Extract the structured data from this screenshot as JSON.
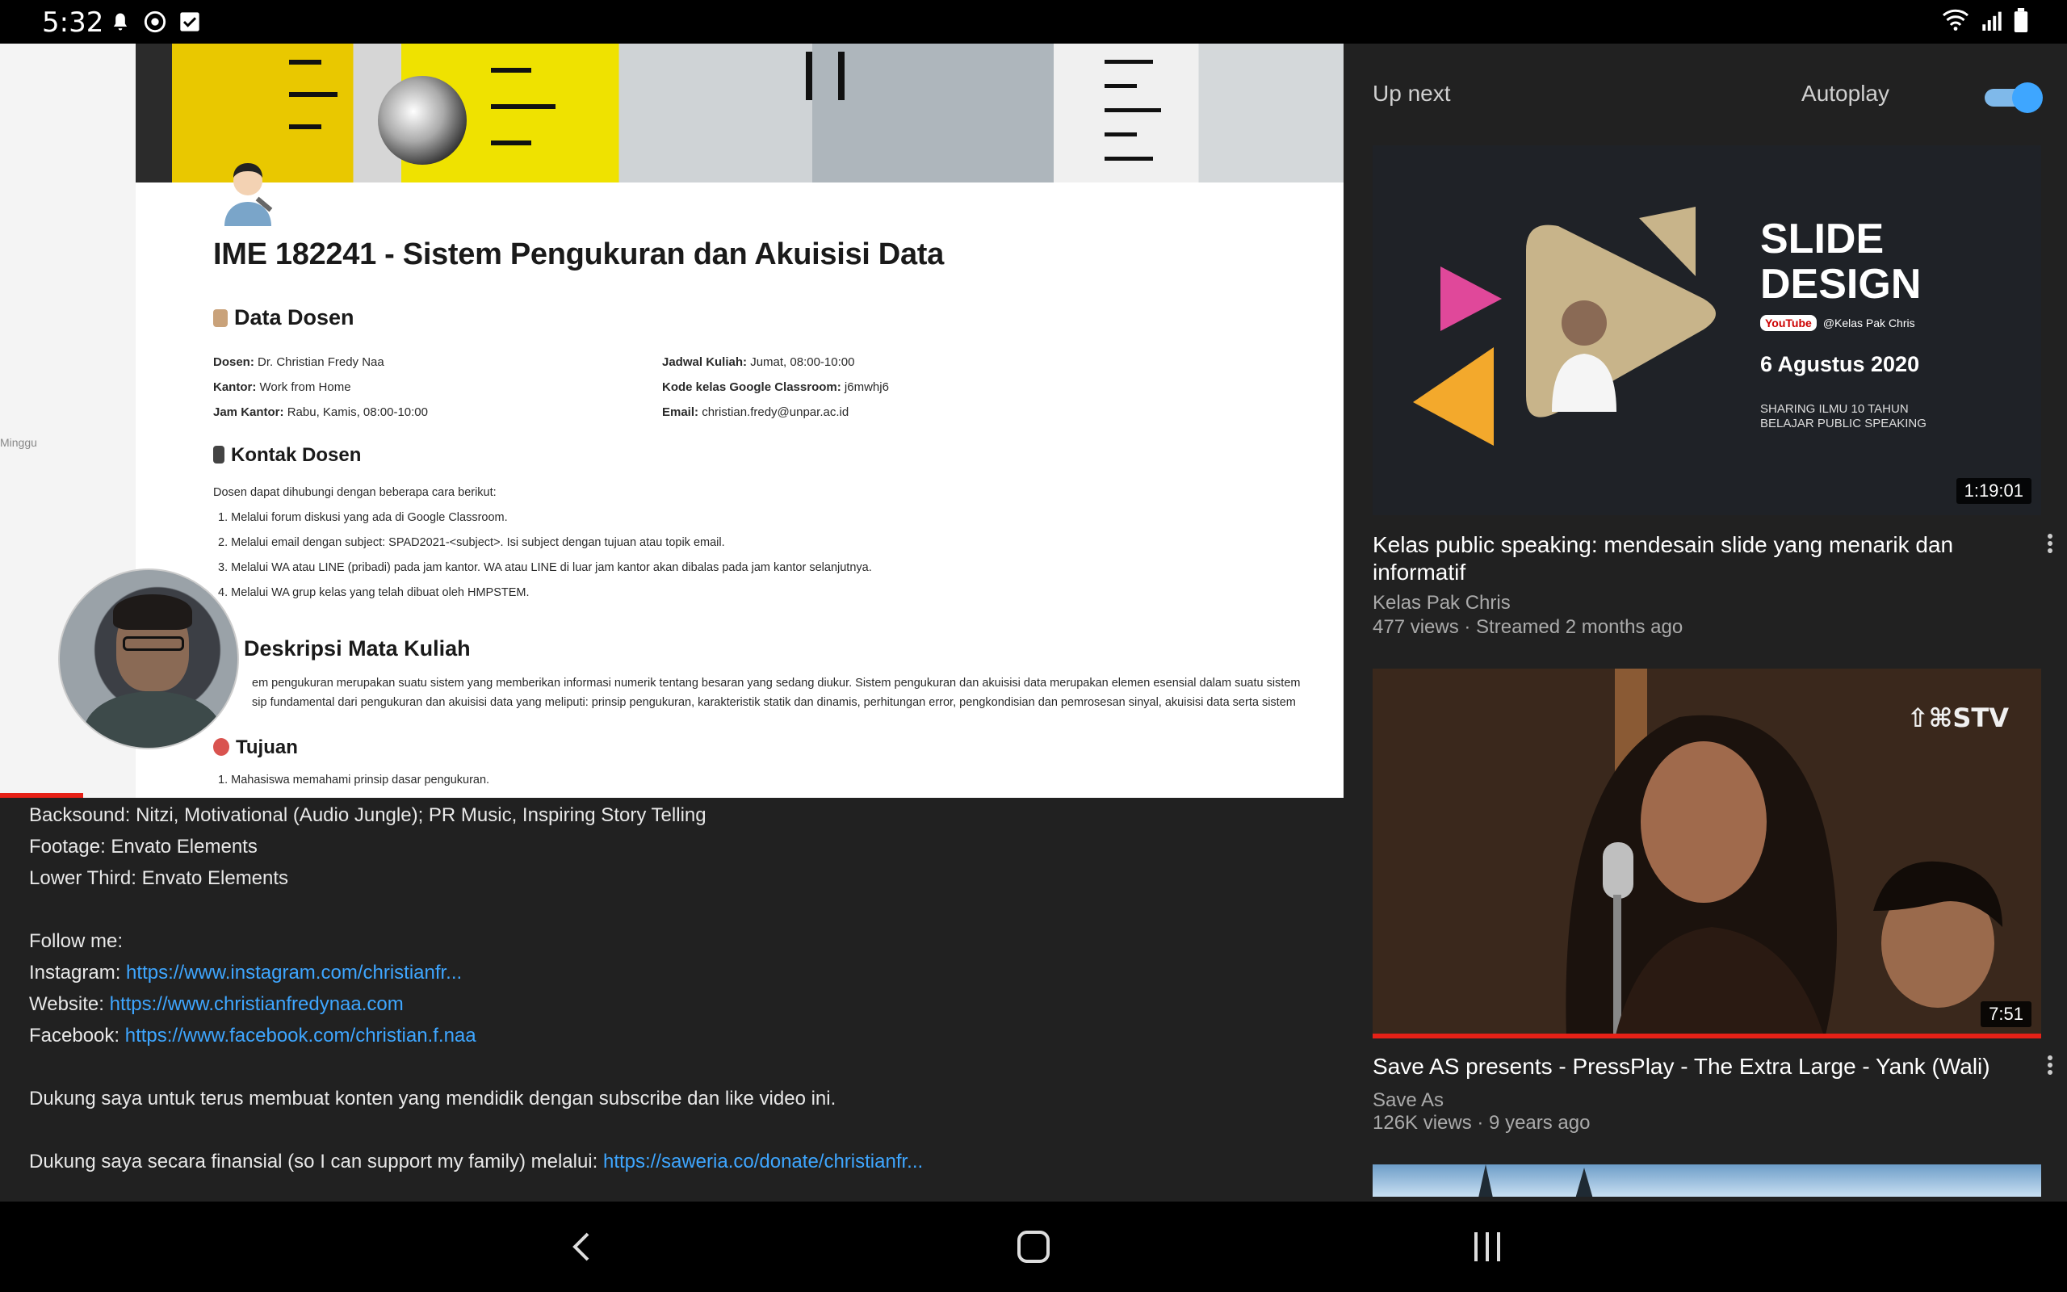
{
  "status_bar": {
    "time": "5:32"
  },
  "player": {
    "doc": {
      "title": "IME 182241 - Sistem Pengukuran dan Akuisisi Data",
      "section_data_dosen": "Data Dosen",
      "dosen_label": "Dosen:",
      "dosen_value": "Dr. Christian Fredy Naa",
      "kantor_label": "Kantor:",
      "kantor_value": "Work from Home",
      "jam_label": "Jam Kantor:",
      "jam_value": "Rabu, Kamis, 08:00-10:00",
      "jadwal_label": "Jadwal Kuliah:",
      "jadwal_value": "Jumat, 08:00-10:00",
      "kode_label": "Kode kelas Google Classroom:",
      "kode_value": "j6mwhj6",
      "email_label": "Email:",
      "email_value": "christian.fredy@unpar.ac.id",
      "section_kontak": "Kontak Dosen",
      "kontak_intro": "Dosen dapat dihubungi dengan beberapa cara berikut:",
      "kontak_items": [
        "1.   Melalui forum diskusi yang ada di Google Classroom.",
        "2.   Melalui email dengan subject: SPAD2021-<subject>. Isi subject dengan tujuan atau topik email.",
        "3.   Melalui WA atau LINE (pribadi) pada jam kantor. WA atau LINE di luar jam kantor akan dibalas pada jam kantor selanjutnya.",
        "4.   Melalui WA grup kelas yang telah dibuat oleh HMPSTEM."
      ],
      "section_deskripsi": "Deskripsi Mata Kuliah",
      "deskripsi_line1": "em pengukuran merupakan suatu sistem yang memberikan informasi numerik tentang besaran yang sedang diukur. Sistem pengukuran dan akuisisi data merupakan elemen esensial dalam suatu sistem",
      "deskripsi_line2": "sip fundamental dari pengukuran dan akuisisi data yang meliputi: prinsip pengukuran, karakteristik statik dan dinamis, perhitungan error, pengkondisian dan pemrosesan sinyal, akuisisi data serta sistem",
      "section_tujuan": "Tujuan",
      "tujuan_1": "1.   Mahasiswa memahami prinsip dasar pengukuran.",
      "side_text": "Minggu"
    },
    "progress_fraction": 0.062
  },
  "description": {
    "backsound": "Backsound: Nitzi, Motivational (Audio Jungle); PR Music, Inspiring Story Telling",
    "footage": "Footage: Envato Elements",
    "lower_third": "Lower Third: Envato Elements",
    "follow": "Follow me:",
    "instagram_label": "Instagram: ",
    "instagram_url": "https://www.instagram.com/christianfr...",
    "website_label": "Website: ",
    "website_url": "https://www.christianfredynaa.com",
    "facebook_label": "Facebook: ",
    "facebook_url": "https://www.facebook.com/christian.f.naa",
    "dukung1": "Dukung saya untuk terus membuat konten yang mendidik dengan subscribe dan like video ini.",
    "dukung2_label": "Dukung saya secara finansial (so I can support my family) melalui: ",
    "dukung2_url": "https://saweria.co/donate/christianfr..."
  },
  "up_next": {
    "header": "Up next",
    "autoplay_label": "Autoplay",
    "autoplay_on": true,
    "videos": [
      {
        "title": "Kelas public speaking: mendesain slide yang menarik dan informatif",
        "channel": "Kelas Pak Chris",
        "meta": "477 views · Streamed 2 months ago",
        "duration": "1:19:01",
        "thumb_text": {
          "line1": "SLIDE",
          "line2": "DESIGN",
          "yt": "YouTube",
          "handle": "@Kelas Pak Chris",
          "date": "6 Agustus 2020",
          "tag1": "SHARING ILMU 10 TAHUN",
          "tag2": "BELAJAR PUBLIC SPEAKING"
        }
      },
      {
        "title": "Save AS presents - PressPlay - The Extra Large - Yank (Wali)",
        "channel": "Save As",
        "meta": "126K views · 9 years ago",
        "duration": "7:51",
        "thumb_text": {
          "logo": "⇧⌘STV"
        },
        "watched_fraction": 1.0
      }
    ]
  },
  "icons": {
    "status": [
      "notification-icon",
      "chrome-icon",
      "check-icon",
      "wifi-icon",
      "signal-icon",
      "battery-icon"
    ],
    "nav": [
      "back-icon",
      "home-icon",
      "recents-icon"
    ]
  },
  "colors": {
    "link": "#3ea6ff",
    "progress": "#e62117",
    "toggle": "#3ea6ff",
    "background": "#212121"
  }
}
